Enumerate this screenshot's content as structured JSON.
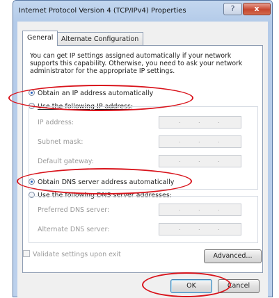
{
  "window": {
    "title": "Internet Protocol Version 4 (TCP/IPv4) Properties",
    "help_glyph": "?",
    "close_glyph": "x"
  },
  "tabs": [
    {
      "label": "General",
      "active": true
    },
    {
      "label": "Alternate Configuration",
      "active": false
    }
  ],
  "general": {
    "info_text": "You can get IP settings assigned automatically if your network supports this capability. Otherwise, you need to ask your network administrator for the appropriate IP settings.",
    "ip_auto_label": "Obtain an IP address automatically",
    "ip_manual_label": "Use the following IP address:",
    "ip_fields": [
      {
        "label": "IP address:"
      },
      {
        "label": "Subnet mask:"
      },
      {
        "label": "Default gateway:"
      }
    ],
    "dns_auto_label": "Obtain DNS server address automatically",
    "dns_manual_label": "Use the following DNS server addresses:",
    "dns_fields": [
      {
        "label": "Preferred DNS server:"
      },
      {
        "label": "Alternate DNS server:"
      }
    ],
    "ip_dot": "."
  },
  "validate_label": "Validate settings upon exit",
  "buttons": {
    "advanced": "Advanced...",
    "ok": "OK",
    "cancel": "Cancel"
  },
  "colors": {
    "annotation": "#d9141c",
    "title_bar": "#b4cbe9",
    "close_button": "#c7472f"
  }
}
